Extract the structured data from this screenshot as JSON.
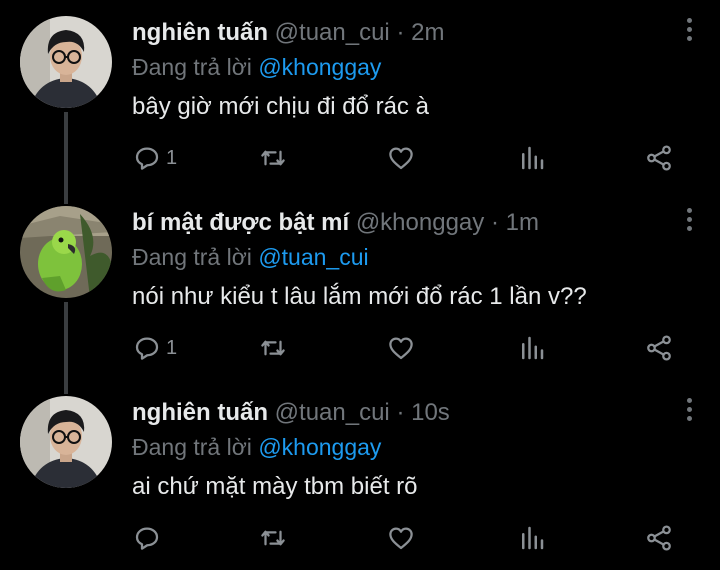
{
  "tweets": [
    {
      "name": "nghiên tuấn",
      "handle": "@tuan_cui",
      "separator": "·",
      "time": "2m",
      "reply_prefix": "Đang trả lời",
      "reply_to": "@khonggay",
      "text": "bây giờ mới chịu đi đổ rác à",
      "reply_count": "1",
      "avatar_icon": "profile-photo-man-glasses"
    },
    {
      "name": "bí mật được bật mí",
      "handle": "@khonggay",
      "separator": "·",
      "time": "1m",
      "reply_prefix": "Đang trả lời",
      "reply_to": "@tuan_cui",
      "text": "nói như kiểu t lâu lắm mới đổ rác 1 lần v??",
      "reply_count": "1",
      "avatar_icon": "profile-photo-green-parrot"
    },
    {
      "name": "nghiên tuấn",
      "handle": "@tuan_cui",
      "separator": "·",
      "time": "10s",
      "reply_prefix": "Đang trả lời",
      "reply_to": "@khonggay",
      "text": "ai chứ mặt mày tbm biết rõ",
      "reply_count": "",
      "avatar_icon": "profile-photo-man-glasses"
    }
  ],
  "colors": {
    "background": "#000000",
    "text": "#e7e9ea",
    "muted": "#71767b",
    "mention": "#1d9bf0",
    "thread_line": "#3a3d40"
  }
}
